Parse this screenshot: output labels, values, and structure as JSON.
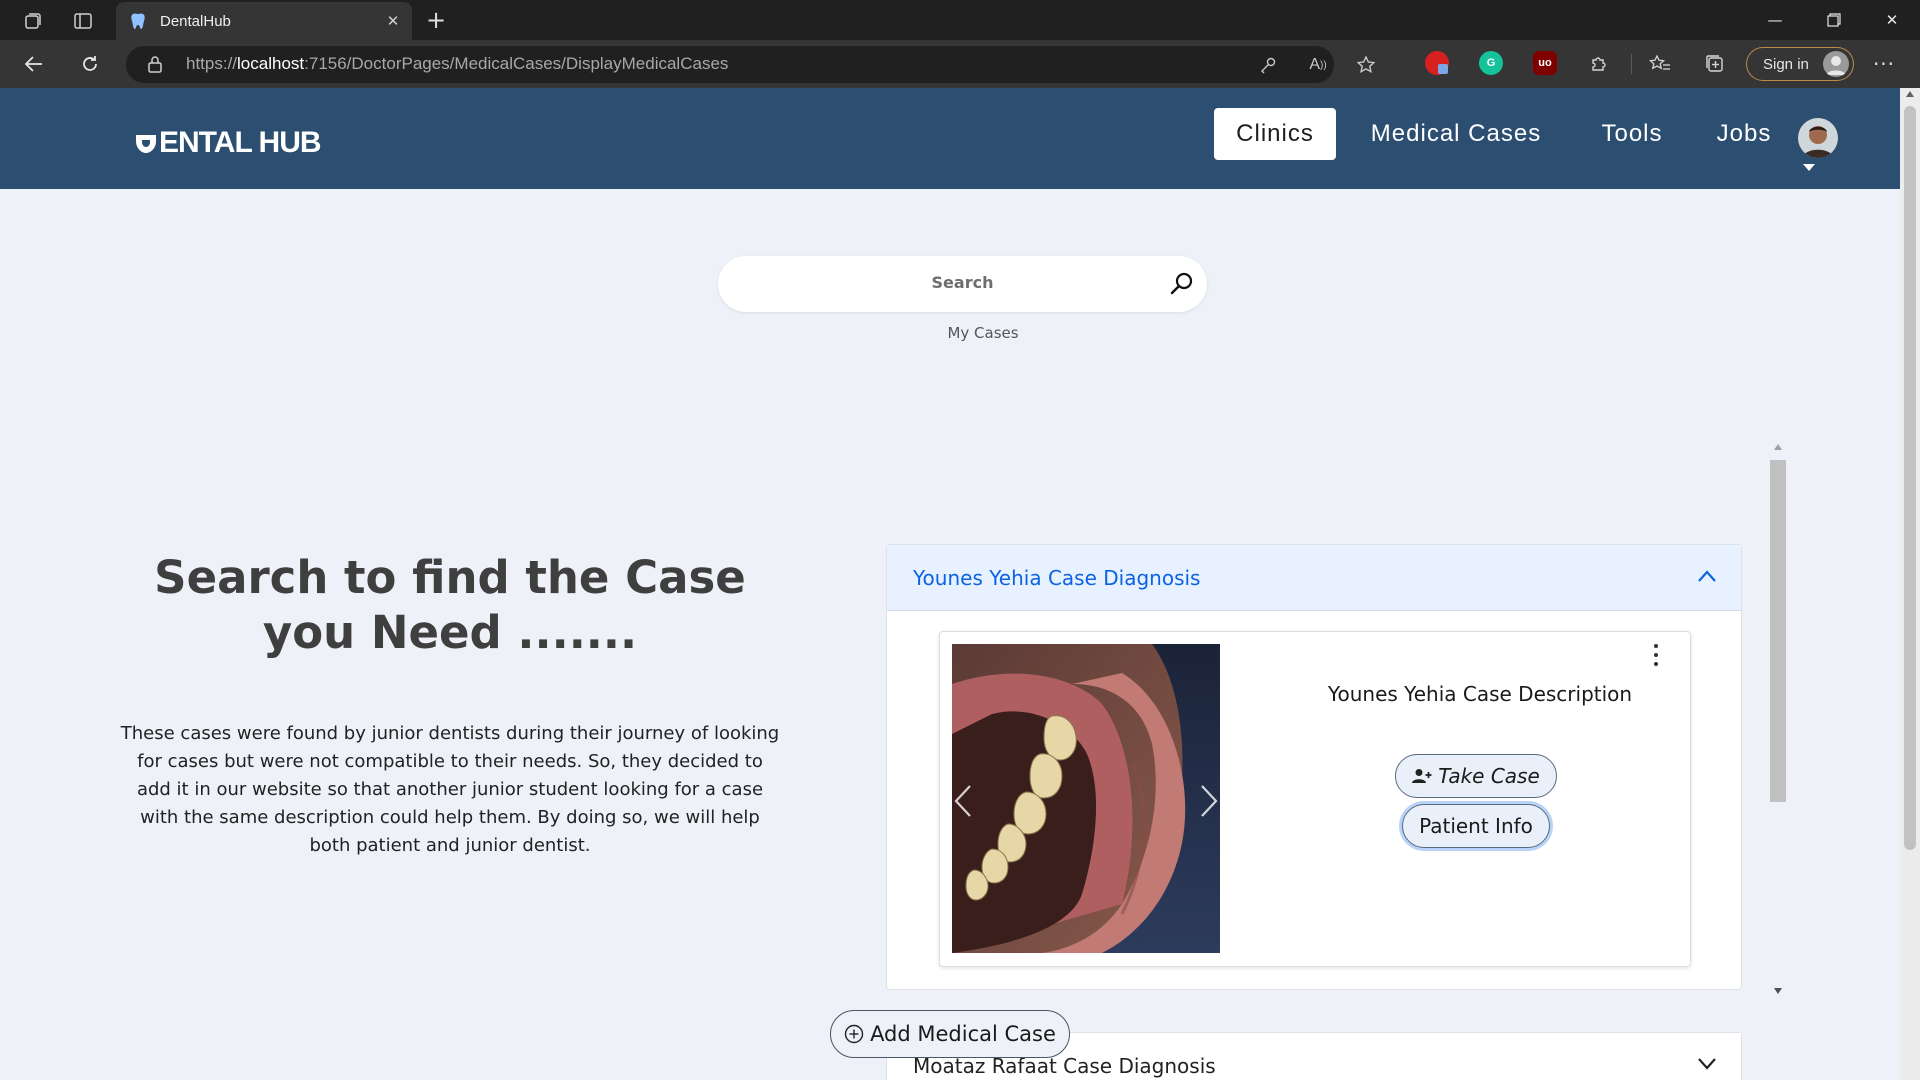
{
  "browser": {
    "tab_title": "DentalHub",
    "url_prefix": "https://",
    "url_host": "localhost",
    "url_path": ":7156/DoctorPages/MedicalCases/DisplayMedicalCases",
    "signin_label": "Sign in",
    "extension_grammarly": "G",
    "extension_ublock": "uo"
  },
  "site": {
    "logo_text": "ENTAL HUB",
    "nav": [
      {
        "label": "Clinics",
        "active": true
      },
      {
        "label": "Medical Cases",
        "active": false
      },
      {
        "label": "Tools",
        "active": false
      },
      {
        "label": "Jobs",
        "active": false
      }
    ]
  },
  "search": {
    "placeholder": "Search",
    "my_cases_label": "My Cases"
  },
  "hero": {
    "title": "Search to find the Case you Need .......",
    "description": "These cases were found by junior dentists during their journey of looking for cases but were not compatible to their needs. So, they decided to add it in our website so that another junior student looking for a case with the same description could help them. By doing so, we will help both patient and junior dentist."
  },
  "cases": [
    {
      "header": "Younes Yehia Case Diagnosis",
      "expanded": true,
      "description": "Younes Yehia Case Description",
      "take_case_label": "Take Case",
      "patient_info_label": "Patient Info"
    },
    {
      "header": "Moataz Rafaat Case Diagnosis",
      "expanded": false
    }
  ],
  "add_case_label": "Add Medical Case",
  "colors": {
    "header_bg": "#2c4e70",
    "page_bg": "#eef1f8",
    "accordion_open_bg": "#e7f1ff",
    "accordion_open_text": "#0c63e4"
  }
}
